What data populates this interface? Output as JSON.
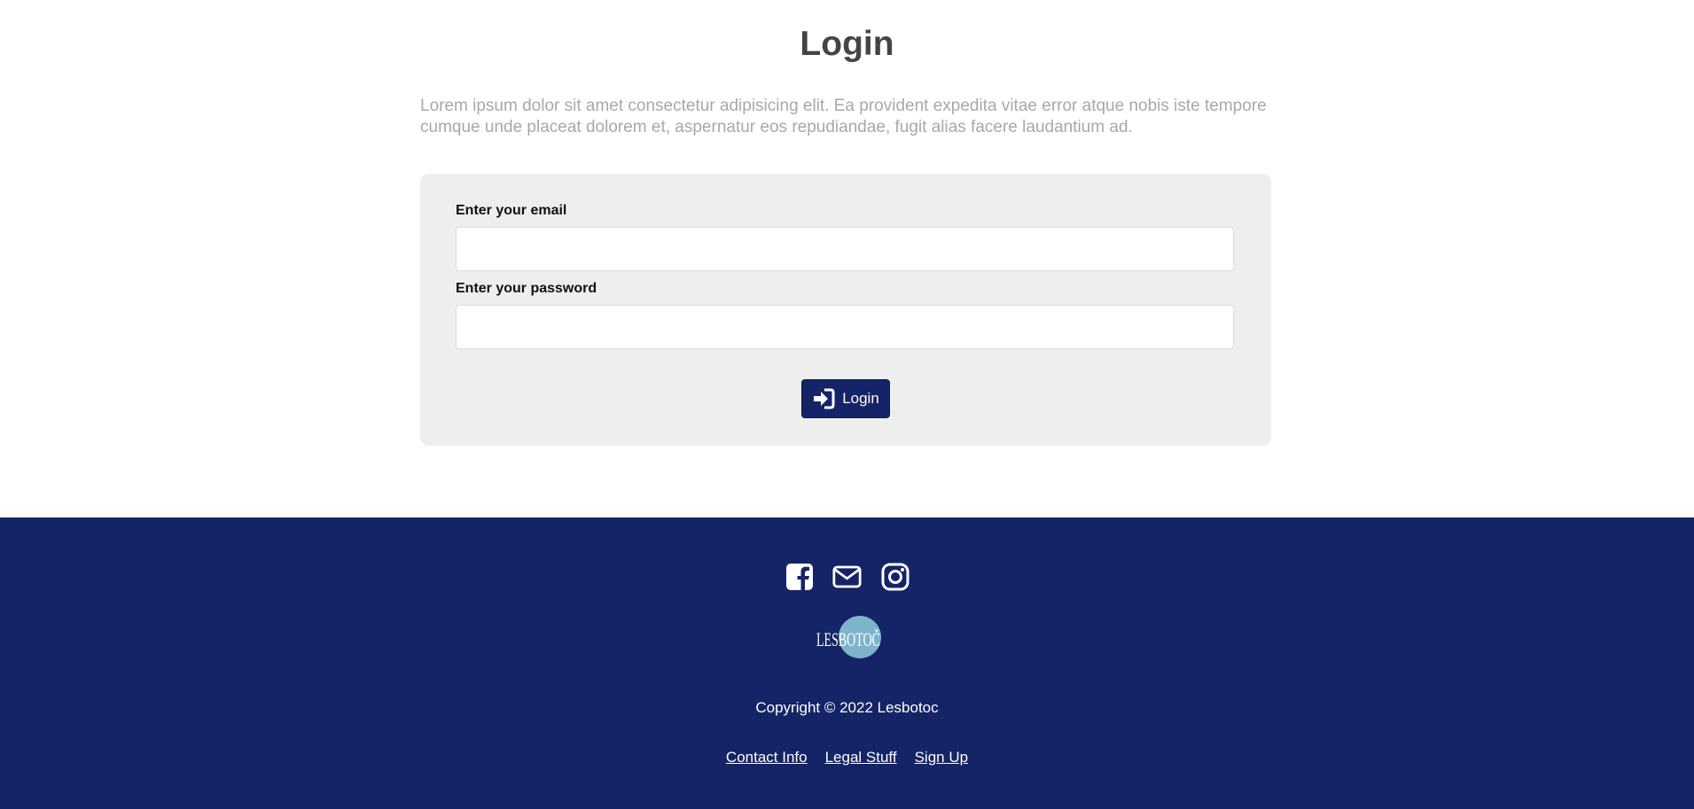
{
  "main": {
    "title": "Login",
    "intro": "Lorem ipsum dolor sit amet consectetur adipisicing elit. Ea provident expedita vitae error atque nobis iste tempore cumque unde placeat dolorem et, aspernatur eos repudiandae, fugit alias facere laudantium ad."
  },
  "form": {
    "email_label": "Enter your email",
    "email_value": "",
    "password_label": "Enter your password",
    "password_value": "",
    "submit_label": "Login",
    "submit_icon": "sign-in-icon"
  },
  "footer": {
    "social_icons": [
      "facebook-icon",
      "envelope-icon",
      "instagram-icon"
    ],
    "logo_text": "LESBOTOČ",
    "copyright": "Copyright © 2022 Lesbotoc",
    "links": [
      "Contact Info",
      "Legal Stuff",
      "Sign Up"
    ]
  },
  "colors": {
    "brand_navy": "#152466",
    "card_gray": "#eeeeee",
    "title_gray": "#444444",
    "intro_gray": "#a8a8a8",
    "logo_circle": "#7db4cb"
  }
}
